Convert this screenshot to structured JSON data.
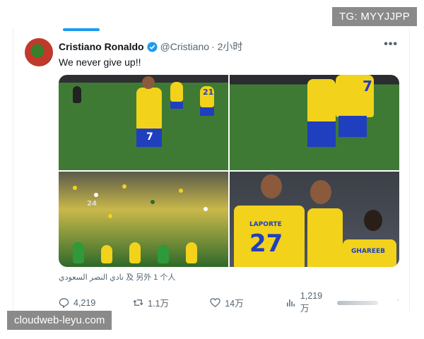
{
  "watermarks": {
    "telegram": "TG: MYYJJPP",
    "site": "cloudweb-leyu.com"
  },
  "tweet": {
    "author_name": "Cristiano Ronaldo",
    "handle": "@Cristiano",
    "time": "· 2小时",
    "text": "We never give up!!",
    "more_icon": "more-horizontal-icon",
    "verified_icon": "verified-badge-icon",
    "attribution": "نادي النصر السعودي 及 另外 1 个人"
  },
  "media": {
    "jersey_numbers": [
      "7",
      "21",
      "24",
      "27",
      "7"
    ],
    "jersey_names": [
      "LAPORTE",
      "GHAREEB"
    ]
  },
  "actions": {
    "replies": "4,219",
    "retweets": "1.1万",
    "likes": "14万",
    "views": "1,219万"
  },
  "colors": {
    "accent": "#1d9bf0",
    "jersey": "#f2d21b",
    "jersey_trim": "#1f3fbf",
    "pitch": "#3f7a34"
  }
}
